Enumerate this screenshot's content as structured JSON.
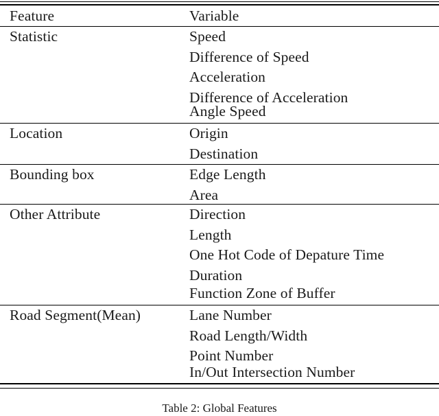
{
  "document": {
    "type": "academic-table",
    "caption": "Table 2: Global Features",
    "text_color": "#1a1a1a",
    "background_color": "#ffffff",
    "rule_color": "#000000"
  },
  "table": {
    "header": {
      "col1": "Feature",
      "col2": "Variable"
    },
    "groups": [
      {
        "feature": "Statistic",
        "variables": [
          "Speed",
          "Difference of Speed",
          "Acceleration",
          "Difference of Acceleration",
          "Angle Speed"
        ]
      },
      {
        "feature": "Location",
        "variables": [
          "Origin",
          "Destination"
        ]
      },
      {
        "feature": "Bounding box",
        "variables": [
          "Edge Length",
          "Area"
        ]
      },
      {
        "feature": "Other Attribute",
        "variables": [
          "Direction",
          "Length",
          "One Hot Code of Depature Time",
          "Duration",
          "Function Zone of Buffer"
        ]
      },
      {
        "feature": "Road Segment(Mean)",
        "variables": [
          "Lane Number",
          "Road Length/Width",
          "Point Number",
          "In/Out Intersection Number"
        ]
      }
    ]
  }
}
